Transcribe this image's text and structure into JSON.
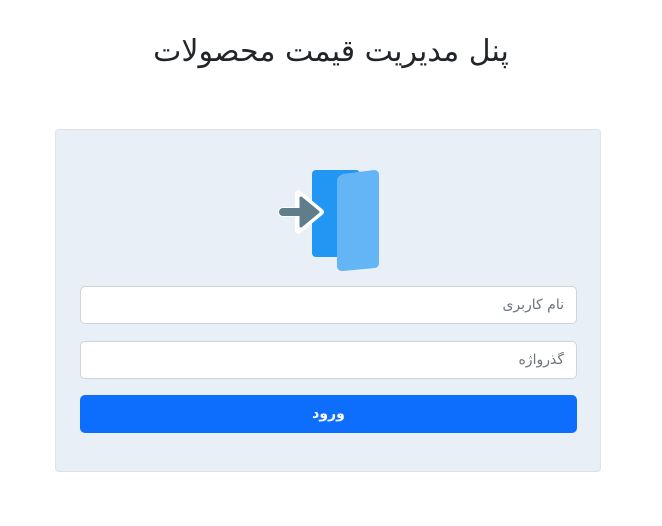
{
  "header": {
    "title": "پنل مدیریت قیمت محصولات"
  },
  "login_form": {
    "icon": "login-door-icon",
    "username": {
      "placeholder": "نام کاربری",
      "value": ""
    },
    "password": {
      "placeholder": "گذرواژه",
      "value": ""
    },
    "submit_label": "ورود"
  },
  "colors": {
    "card_background": "#e9eff7",
    "primary_button": "#0d6efd",
    "icon_door_dark": "#2196f3",
    "icon_door_light": "#64b5f6",
    "icon_arrow": "#607d8b"
  }
}
